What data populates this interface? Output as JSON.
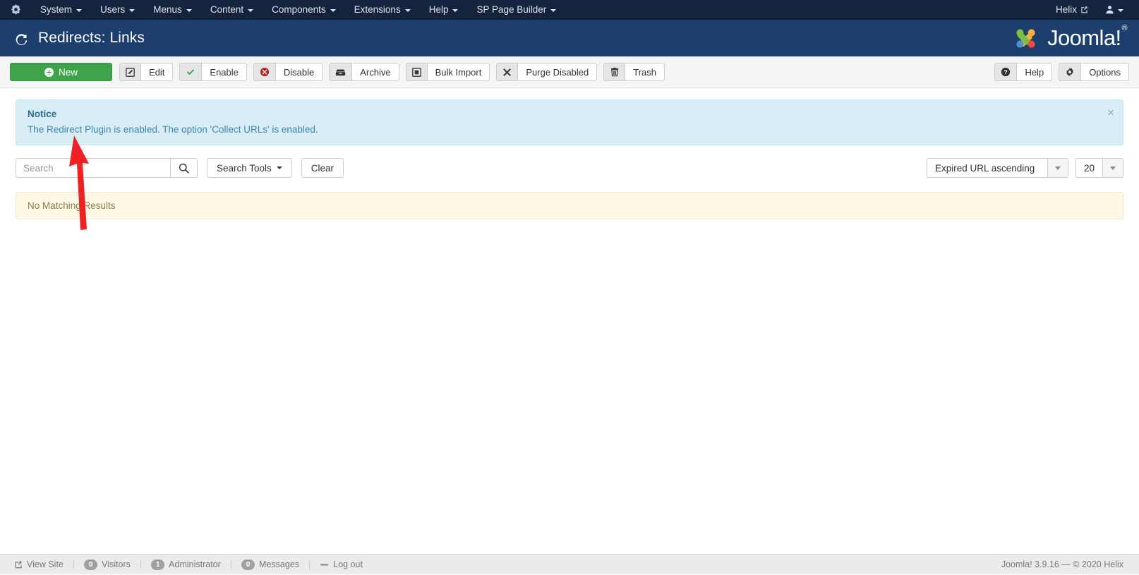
{
  "topbar": {
    "brand_icon": "joomla-brand-icon",
    "menus": [
      {
        "label": "System",
        "icon": "chevron-down-icon"
      },
      {
        "label": "Users",
        "icon": "chevron-down-icon"
      },
      {
        "label": "Menus",
        "icon": "chevron-down-icon"
      },
      {
        "label": "Content",
        "icon": "chevron-down-icon"
      },
      {
        "label": "Components",
        "icon": "chevron-down-icon"
      },
      {
        "label": "Extensions",
        "icon": "chevron-down-icon"
      },
      {
        "label": "Help",
        "icon": "chevron-down-icon"
      },
      {
        "label": "SP Page Builder",
        "icon": "chevron-down-icon"
      }
    ],
    "site_name": "Helix",
    "site_icon": "external-link-icon",
    "user_icon": "user-icon"
  },
  "header": {
    "title": "Redirects: Links",
    "title_icon": "redo-arrow-icon",
    "logo_text": "Joomla!",
    "logo_reg": "®"
  },
  "toolbar": {
    "new_label": "New",
    "new_icon": "plus-circle-icon",
    "buttons": [
      {
        "label": "Edit",
        "icon": "pencil-square-icon"
      },
      {
        "label": "Enable",
        "icon": "check-icon"
      },
      {
        "label": "Disable",
        "icon": "times-circle-icon"
      },
      {
        "label": "Archive",
        "icon": "archive-box-icon"
      },
      {
        "label": "Bulk Import",
        "icon": "stop-square-icon"
      },
      {
        "label": "Purge Disabled",
        "icon": "times-icon"
      },
      {
        "label": "Trash",
        "icon": "trash-icon"
      }
    ],
    "right_buttons": [
      {
        "label": "Help",
        "icon": "question-circle-icon"
      },
      {
        "label": "Options",
        "icon": "gear-icon"
      }
    ]
  },
  "notice": {
    "title": "Notice",
    "text": "The Redirect Plugin is enabled. The option 'Collect URLs' is enabled.",
    "close_icon": "close-icon",
    "close_glyph": "×"
  },
  "filters": {
    "search_placeholder": "Search",
    "search_value": "",
    "search_icon": "search-icon",
    "search_tools_label": "Search Tools",
    "clear_label": "Clear",
    "sort_value": "Expired URL ascending",
    "limit_value": "20"
  },
  "list": {
    "empty_message": "No Matching Results"
  },
  "annotation": {
    "type": "red-arrow",
    "color": "#ee2222",
    "points_to": "New"
  },
  "footer": {
    "view_site_label": "View Site",
    "view_site_icon": "external-link-icon",
    "visitors_count": "0",
    "visitors_label": "Visitors",
    "administrator_count": "1",
    "administrator_label": "Administrator",
    "messages_count": "0",
    "messages_label": "Messages",
    "logout_label": "Log out",
    "logout_icon": "minus-icon",
    "copyright": "Joomla! 3.9.16  —  © 2020 Helix"
  },
  "colors": {
    "topbar_bg": "#14243f",
    "subhead_bg": "#1c3f6e",
    "new_button": "#3ea34a",
    "notice_bg": "#d9edf7",
    "warning_bg": "#fcf8e3",
    "annotation_red": "#ee2222"
  }
}
